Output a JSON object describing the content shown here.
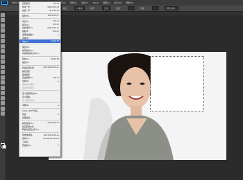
{
  "menubar": {
    "logo": "Ps",
    "items": [
      "文件(F)",
      "编辑(E)",
      "图像(I)",
      "图层(L)",
      "类型(Y)",
      "选择(S)",
      "滤镜(T)",
      "3D(D)",
      "视图(V)",
      "窗口(W)",
      "帮助(H)"
    ]
  },
  "options": {
    "feather": "羽化：",
    "feather_value": "0 像素",
    "style": "样式：",
    "style_value": "正常",
    "width": "宽度：",
    "height": "高度：",
    "refine": "调整边缘..."
  },
  "menu": {
    "items": [
      {
        "label": "还原套索",
        "shortcut": "Ctrl+Z"
      },
      {
        "label": "前进一步",
        "shortcut": "Shift+Ctrl+Z"
      },
      {
        "label": "后退一步",
        "shortcut": "Alt+Ctrl+Z"
      },
      {
        "sep": true
      },
      {
        "label": "渐隐(D)...",
        "shortcut": "Shift+Ctrl+F"
      },
      {
        "sep": true
      },
      {
        "label": "剪切(T)",
        "shortcut": "Ctrl+X"
      },
      {
        "label": "拷贝(C)",
        "shortcut": "Ctrl+C"
      },
      {
        "label": "合并拷贝(Y)",
        "shortcut": "Shift+Ctrl+C"
      },
      {
        "label": "粘贴(P)",
        "shortcut": "Ctrl+V"
      },
      {
        "label": "选择性粘贴(I)",
        "arrow": true
      },
      {
        "label": "清除(E)"
      },
      {
        "label": "填充(L)...",
        "shortcut": "Shift+F5",
        "highlight": true
      },
      {
        "sep": true
      },
      {
        "label": "描边(S)..."
      },
      {
        "label": "拼写检查(H)..."
      },
      {
        "label": "查找和替换文本(X)..."
      },
      {
        "sep": true
      },
      {
        "label": "填充(L)...",
        "shortcut": "Shift+F5"
      },
      {
        "label": "描边(S)..."
      },
      {
        "sep": true
      },
      {
        "label": "内容识别比例",
        "shortcut": "Alt+Shift+Ctrl+C"
      },
      {
        "label": "操控变形"
      },
      {
        "label": "透视变形"
      },
      {
        "label": "自由变换(F)",
        "shortcut": "Ctrl+T"
      },
      {
        "label": "变换(A)",
        "arrow": true
      },
      {
        "label": "自动对齐图层...",
        "disabled": true
      },
      {
        "label": "自动混合图层...",
        "disabled": true
      },
      {
        "sep": true
      },
      {
        "label": "定义画笔预设(B)..."
      },
      {
        "label": "定义图案..."
      },
      {
        "label": "定义自定形状...",
        "disabled": true
      },
      {
        "sep": true
      },
      {
        "label": "清理(R)",
        "arrow": true
      },
      {
        "sep": true
      },
      {
        "label": "Adobe PDF 预设..."
      },
      {
        "label": "预设",
        "arrow": true
      },
      {
        "label": "远程连接..."
      },
      {
        "sep": true
      },
      {
        "label": "颜色设置(G)...",
        "shortcut": "Shift+Ctrl+K"
      },
      {
        "label": "指定配置文件..."
      },
      {
        "label": "转换为配置文件(V)..."
      },
      {
        "sep": true
      },
      {
        "label": "键盘快捷键...",
        "shortcut": "Alt+Shift+Ctrl+K"
      },
      {
        "label": "菜单(U)...",
        "shortcut": "Alt+Shift+Ctrl+M"
      },
      {
        "label": "工具栏..."
      },
      {
        "label": "首选项(N)",
        "arrow": true
      }
    ]
  },
  "colors": {
    "menu_highlight": "#3d6fd6",
    "app_bg": "#2b2b2b"
  }
}
